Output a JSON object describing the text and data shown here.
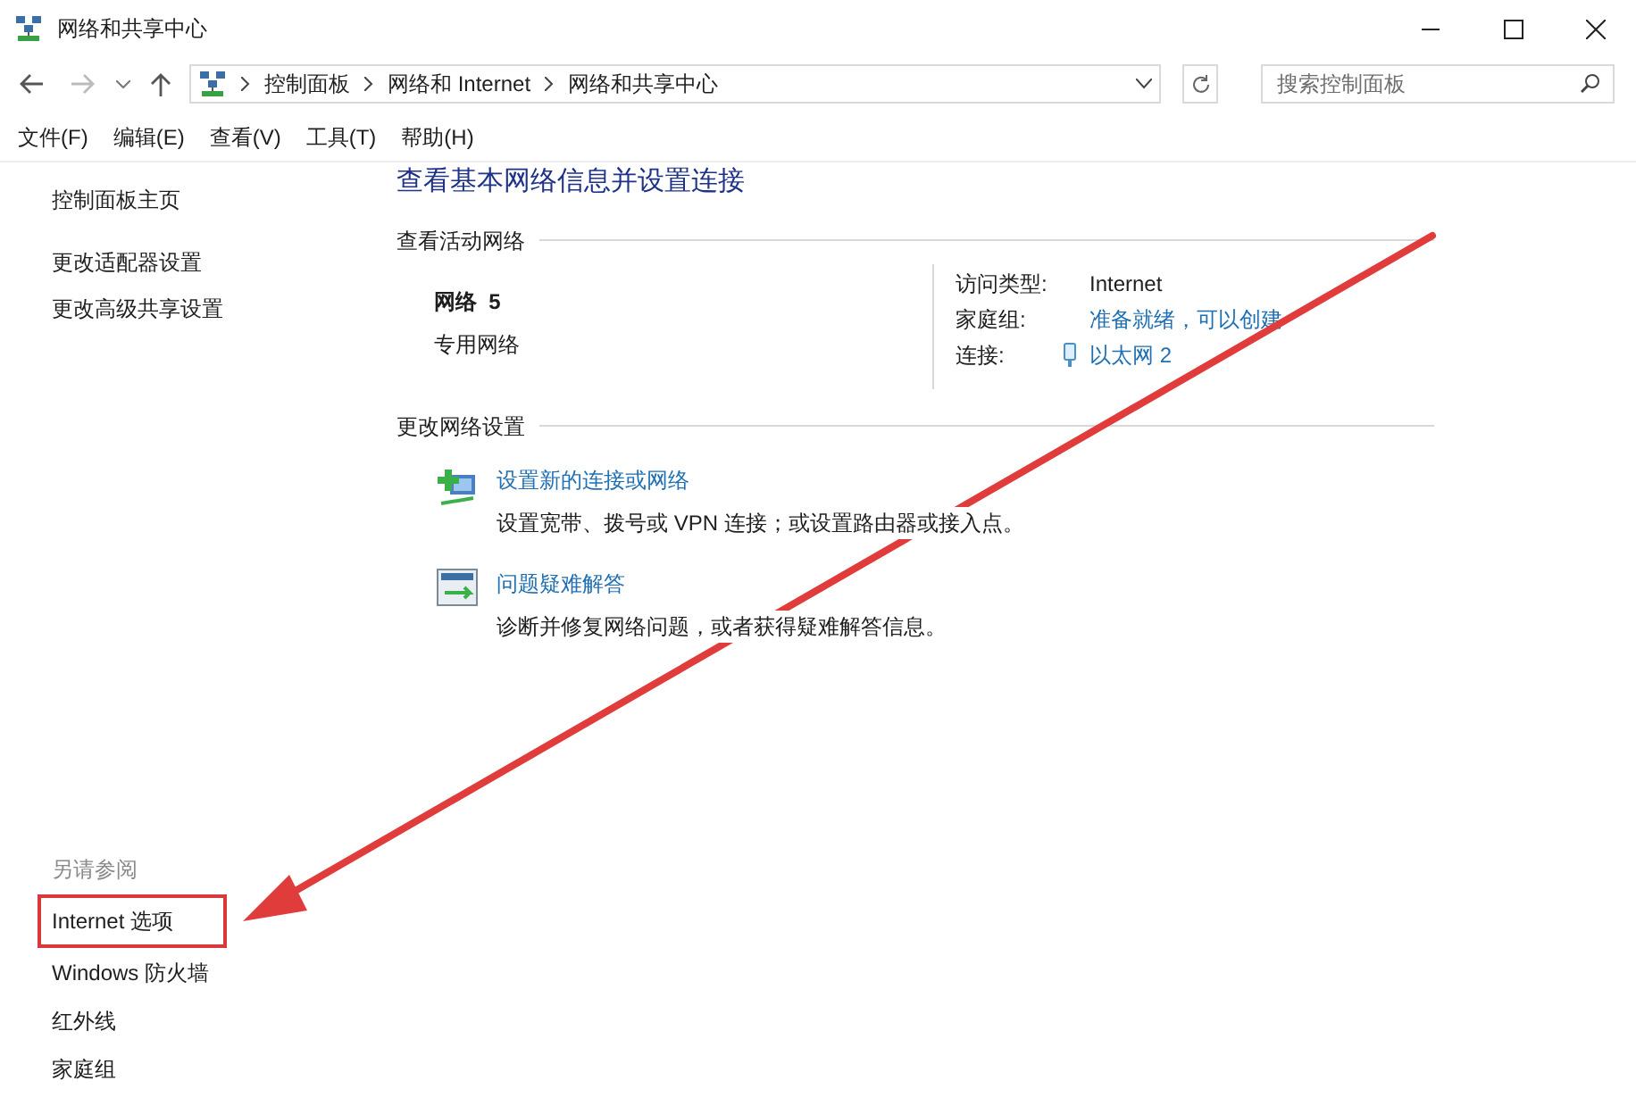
{
  "window": {
    "title": "网络和共享中心"
  },
  "address_bar": {
    "crumbs": [
      "控制面板",
      "网络和 Internet",
      "网络和共享中心"
    ]
  },
  "search": {
    "placeholder": "搜索控制面板"
  },
  "menu": [
    "文件(F)",
    "编辑(E)",
    "查看(V)",
    "工具(T)",
    "帮助(H)"
  ],
  "sidebar": {
    "home_link": "控制面板主页",
    "task_links": [
      "更改适配器设置",
      "更改高级共享设置"
    ],
    "see_also": {
      "heading": "另请参阅",
      "links": [
        {
          "label": "Internet 选项",
          "highlighted": true
        },
        {
          "label": "Windows 防火墙",
          "highlighted": false
        },
        {
          "label": "红外线",
          "highlighted": false
        },
        {
          "label": "家庭组",
          "highlighted": false
        }
      ]
    }
  },
  "main": {
    "title": "查看基本网络信息并设置连接",
    "active_networks": {
      "heading": "查看活动网络",
      "name": "网络  5",
      "type": "专用网络",
      "properties": [
        {
          "label": "访问类型:",
          "value": "Internet",
          "kind": "text"
        },
        {
          "label": "家庭组:",
          "value": "准备就绪，可以创建",
          "kind": "link"
        },
        {
          "label": "连接:",
          "value": "以太网 2",
          "kind": "connection"
        }
      ]
    },
    "change_settings": {
      "heading": "更改网络设置",
      "tasks": [
        {
          "kind": "new-connection",
          "title": "设置新的连接或网络",
          "description": "设置宽带、拨号或 VPN 连接；或设置路由器或接入点。"
        },
        {
          "kind": "troubleshoot",
          "title": "问题疑难解答",
          "description": "诊断并修复网络问题，或者获得疑难解答信息。"
        }
      ]
    }
  },
  "annotation": {
    "kind": "arrow",
    "color": "#e03c3c"
  }
}
